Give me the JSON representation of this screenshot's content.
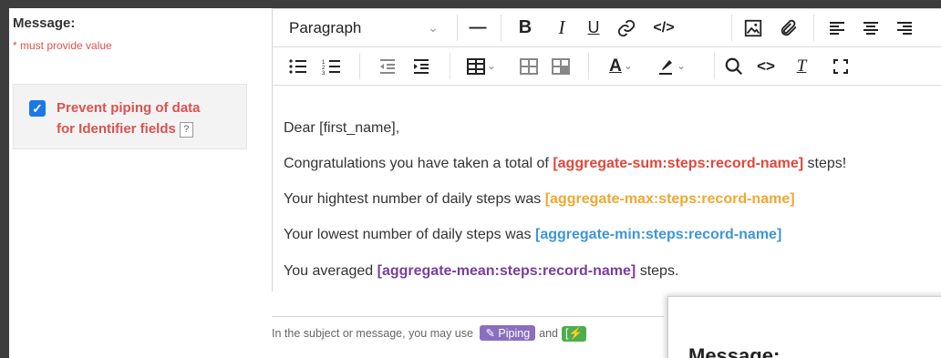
{
  "field": {
    "label": "Message:",
    "required_note": "* must provide value"
  },
  "pipe_option": {
    "checked": true,
    "line1": "Prevent piping of data",
    "line2": "for Identifier fields",
    "help": "?"
  },
  "toolbar": {
    "format_select": "Paragraph",
    "bold": "B",
    "italic": "I",
    "underline": "U",
    "text_color": "A"
  },
  "body": {
    "greeting": "Dear [first_name],",
    "line2_text": "Congratulations you have taken a total of",
    "line2_tag": "[aggregate-sum:steps:record-name]",
    "line2_suffix": " steps!",
    "line3_text": "Your hightest number of daily steps was",
    "line3_tag": "[aggregate-max:steps:record-name]",
    "line4_text": "Your lowest number of daily steps was ",
    "line4_tag": "[aggregate-min:steps:record-name]",
    "line5_text": "You averaged",
    "line5_tag": "[aggregate-mean:steps:record-name]",
    "line5_suffix": " steps."
  },
  "hint": {
    "prefix": "In the subject or message, you may use",
    "piping_label": "Piping",
    "and": "and",
    "green_label": "[⚡"
  },
  "preview": {
    "title": "Message:"
  },
  "colors": {
    "red_tag": "#e0473a",
    "orange_tag": "#f0a830",
    "blue_tag": "#3d96d9",
    "purple_tag": "#7a3e9d",
    "required": "#d9534f"
  }
}
